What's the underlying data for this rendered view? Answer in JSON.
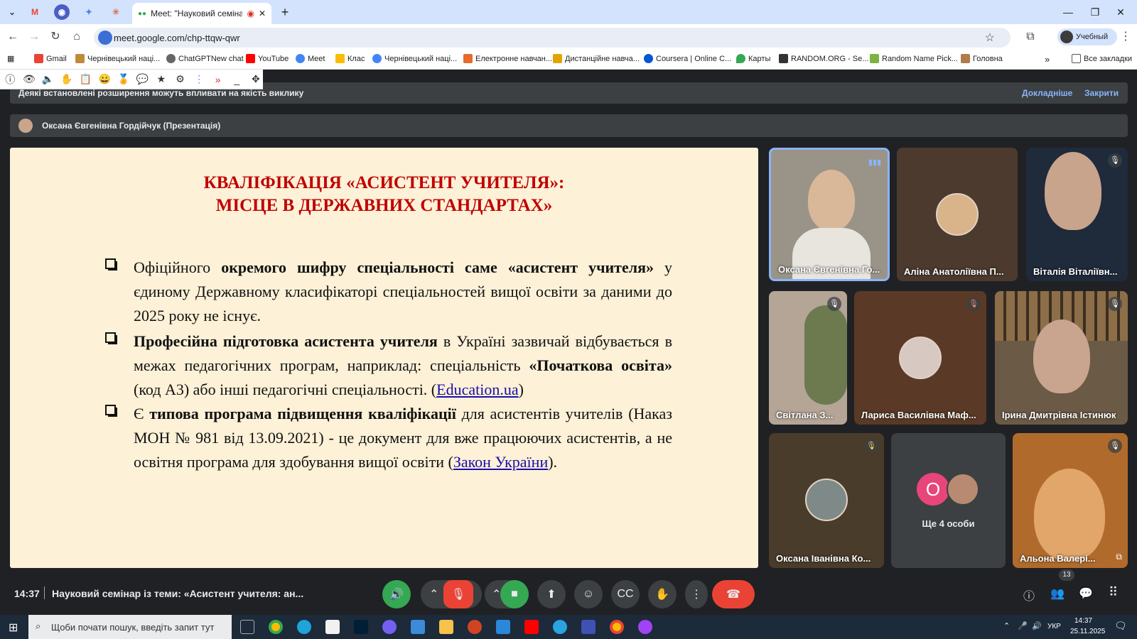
{
  "browser": {
    "active_tab_title": "Meet: \"Науковий семінар і",
    "url": "meet.google.com/chp-ttqw-qwr",
    "profile_label": "Учебный",
    "all_bookmarks": "Все закладки",
    "bookmarks": [
      "Gmail",
      "Чернівецький наці...",
      "ChatGPTNew chat",
      "YouTube",
      "Meet",
      "Клас",
      "Чернівецький наці...",
      "Електронне навчан...",
      "Дистанційне навча...",
      "Coursera | Online C...",
      "Карты",
      "RANDOM.ORG - Se...",
      "Random Name Pick...",
      "Головна"
    ]
  },
  "meet": {
    "banner_text": "Деякі встановлені розширення можуть впливати на якість виклику",
    "banner_more": "Докладніше",
    "banner_close": "Закрити",
    "presenter_label": "Оксана Євгенівна Гордійчук (Презентація)",
    "slide": {
      "title_line1": "КВАЛІФІКАЦІЯ «АСИСТЕНТ УЧИТЕЛЯ»:",
      "title_line2": "МІСЦЕ В ДЕРЖАВНИХ СТАНДАРТАХ»",
      "b1_a": "Офіційного ",
      "b1_bold": "окремого шифру спеціальності саме «асистент учителя»",
      "b1_b": " у єдиному Державному класифікаторі спеціальностей вищої освіти за даними до 2025 року не існує.",
      "b2_bold": "Професійна підготовка асистента учителя",
      "b2_a": " в Україні зазвичай відбувається в межах педагогічних програм, наприклад: спеціальність ",
      "b2_bold2": "«Початкова освіта»",
      "b2_b": " (код А3) або інші педагогічні спеціальності. (",
      "b2_link": "Education.ua",
      "b2_c": ")",
      "b3_a": "Є ",
      "b3_bold": "типова програма підвищення кваліфікації",
      "b3_b": " для асистентів учителів (Наказ МОН № 981 від 13.09.2021) - це  документ для вже працюючих асистентів, а не освітня програма для здобування вищої освіти (",
      "b3_link": "Закон України",
      "b3_c": ")."
    },
    "participants": [
      {
        "name": "Оксана Євгенівна Го...",
        "state": "speaking"
      },
      {
        "name": "Аліна Анатоліївна П...",
        "state": "avatar"
      },
      {
        "name": "Віталія Віталіївн...",
        "state": "muted"
      },
      {
        "name": "Світлана З...",
        "state": "muted"
      },
      {
        "name": "Лариса Василівна Маф...",
        "state": "muted"
      },
      {
        "name": "Ірина Дмитрівна Істинюк",
        "state": "muted"
      },
      {
        "name": "Оксана Іванівна Ко...",
        "state": "muted"
      },
      {
        "name": "Ще 4 особи",
        "state": "group"
      },
      {
        "name": "Альона Валері...",
        "state": "muted"
      }
    ],
    "more_avatar_letter": "О",
    "time": "14:37",
    "meeting_title": "Науковий семінар із теми: «Асистент учителя: ан...",
    "people_count": "13"
  },
  "taskbar": {
    "search_placeholder": "Щоби почати пошук, введіть запит тут",
    "lang": "УКР",
    "clock_time": "14:37",
    "clock_date": "25.11.2025"
  },
  "colors": {
    "accent_green": "#34a853",
    "end_call_red": "#ea4335",
    "title_red": "#c00000"
  }
}
